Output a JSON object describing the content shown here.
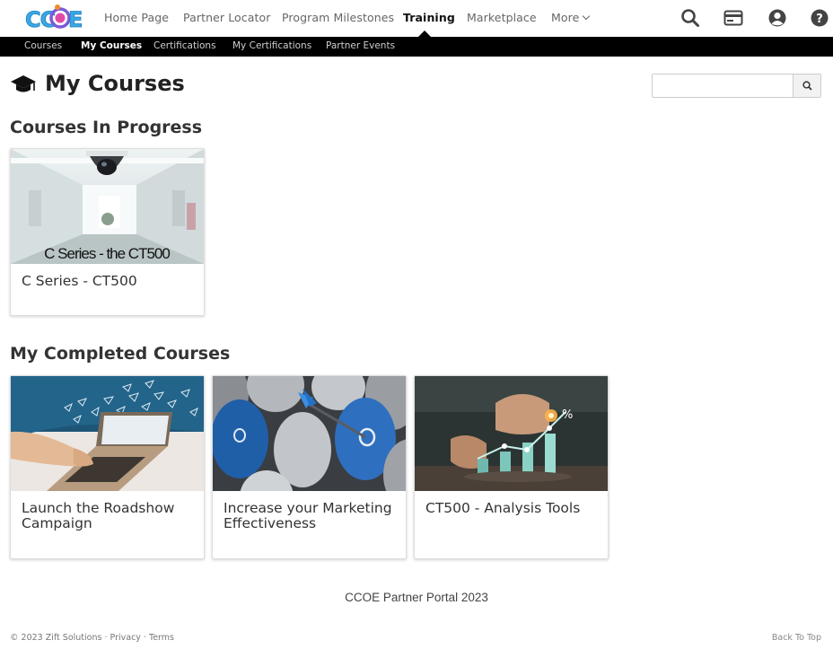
{
  "brand": {
    "logo_text": "CCOE",
    "accent": "#1aa6e0",
    "logo_ring": "#e040a0"
  },
  "nav": {
    "items": [
      {
        "label": "Home Page"
      },
      {
        "label": "Partner Locator"
      },
      {
        "label": "Program Milestones"
      },
      {
        "label": "Training"
      },
      {
        "label": "Marketplace"
      },
      {
        "label": "More"
      }
    ],
    "active": "Training",
    "icons": [
      "search-icon",
      "card-icon",
      "user-icon",
      "help-icon"
    ]
  },
  "subnav": {
    "items": [
      {
        "label": "Courses"
      },
      {
        "label": "My Courses"
      },
      {
        "label": "Certifications"
      },
      {
        "label": "My Certifications"
      },
      {
        "label": "Partner Events"
      }
    ],
    "active": "My Courses"
  },
  "page": {
    "title": "My Courses",
    "search": {
      "value": "",
      "placeholder": ""
    }
  },
  "in_progress": {
    "title": "Courses In Progress",
    "courses": [
      {
        "title": "C Series - CT500",
        "image_caption": "C Series - the CT500"
      }
    ]
  },
  "completed": {
    "title": "My Completed Courses",
    "courses": [
      {
        "title": "Launch the Roadshow Campaign"
      },
      {
        "title": "Increase your Marketing Effectiveness"
      },
      {
        "title": "CT500 - Analysis Tools"
      }
    ]
  },
  "footer": {
    "portal": "CCOE Partner Portal 2023",
    "copyright": "© 2023",
    "company": "Zift Solutions",
    "privacy": "Privacy",
    "terms": "Terms",
    "back_to_top": "Back To Top"
  }
}
